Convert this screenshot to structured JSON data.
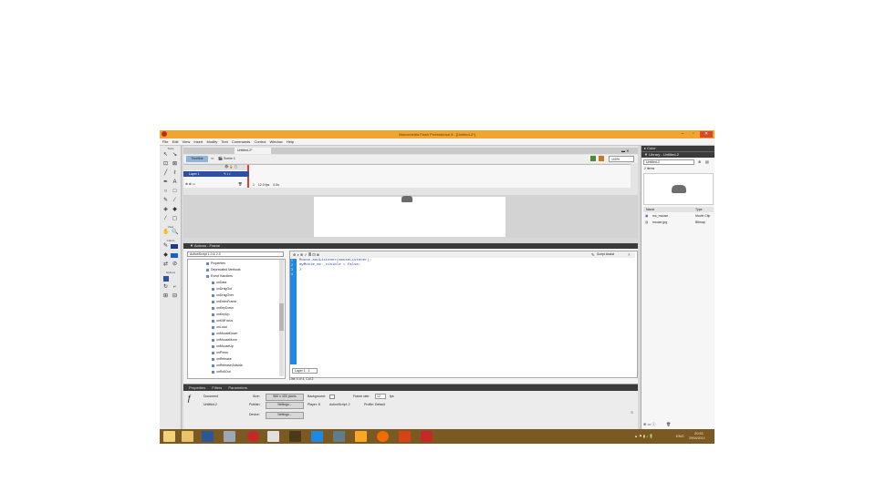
{
  "window": {
    "title": "Macromedia Flash Professional 8 - [Untitled-2*]",
    "minimize": "–",
    "maximize": "▫",
    "close": "✕"
  },
  "menu": [
    "File",
    "Edit",
    "View",
    "Insert",
    "Modify",
    "Text",
    "Commands",
    "Control",
    "Window",
    "Help"
  ],
  "tools": {
    "header": "Tools",
    "view_header": "View",
    "colors_header": "Colors",
    "options_header": "Options"
  },
  "timeline": {
    "doc_tab": "Untitled-2*",
    "timeline_btn": "Timeline",
    "scene": "Scene 1",
    "zoom": "100%",
    "layer": "Layer 1",
    "fps": "12.0 fps",
    "time": "0.0s",
    "frame": "1"
  },
  "actions": {
    "panel_title": "▼ Actions - Frame",
    "script_target": "ActionScript 1.0 & 2.0",
    "script_assist": "Script Assist",
    "tree_items": [
      "Properties",
      "Deprecated Methods",
      "Event Handlers",
      "onData",
      "onDragOut",
      "onDragOver",
      "onEnterFrame",
      "onKeyDown",
      "onKeyUp",
      "onKillFocus",
      "onLoad",
      "onMouseDown",
      "onMouseMove",
      "onMouseUp",
      "onPress",
      "onRelease",
      "onReleaseOutside",
      "onRollOut"
    ],
    "code_lines": [
      "Mouse.addListener(mouseListener);",
      "    myMovie_mc._visible = false;",
      "}"
    ],
    "line_numbers": [
      "1",
      "2",
      "3",
      "4"
    ],
    "status_tab": "Layer 1 : 1",
    "line_info": "Line 4 of 4, Col 2"
  },
  "properties": {
    "tabs": [
      "Properties",
      "Filters",
      "Parameters"
    ],
    "doc_label": "Document",
    "doc_name": "Untitled-2",
    "size_label": "Size:",
    "size_value": "550 x 400 pixels",
    "bg_label": "Background:",
    "fps_label": "Frame rate:",
    "fps_value": "12",
    "fps_unit": "fps",
    "publish_label": "Publish:",
    "settings_btn": "Settings...",
    "player_text": "Player: 8",
    "actionscript_text": "ActionScript: 2",
    "profile_text": "Profile: Default",
    "device_label": "Device:"
  },
  "library": {
    "color_header": "▸ Color",
    "library_header": "▼ Library - Untitled-2",
    "dropdown": "Untitled-2",
    "items_count": "2 items",
    "col_name": "Name",
    "col_type": "Type",
    "items": [
      {
        "name": "mc_mouse",
        "type": "Movie Clip"
      },
      {
        "name": "mouse.jpg",
        "type": "Bitmap"
      }
    ]
  },
  "taskbar": {
    "lang": "ENG",
    "time": "20:51",
    "date": "29/04/2014"
  },
  "colors": {
    "titlebar": "#f0a431",
    "close": "#d9492e",
    "taskbar": "#7a5a22",
    "gutter": "#1e88e5",
    "playhead": "#e53935"
  }
}
